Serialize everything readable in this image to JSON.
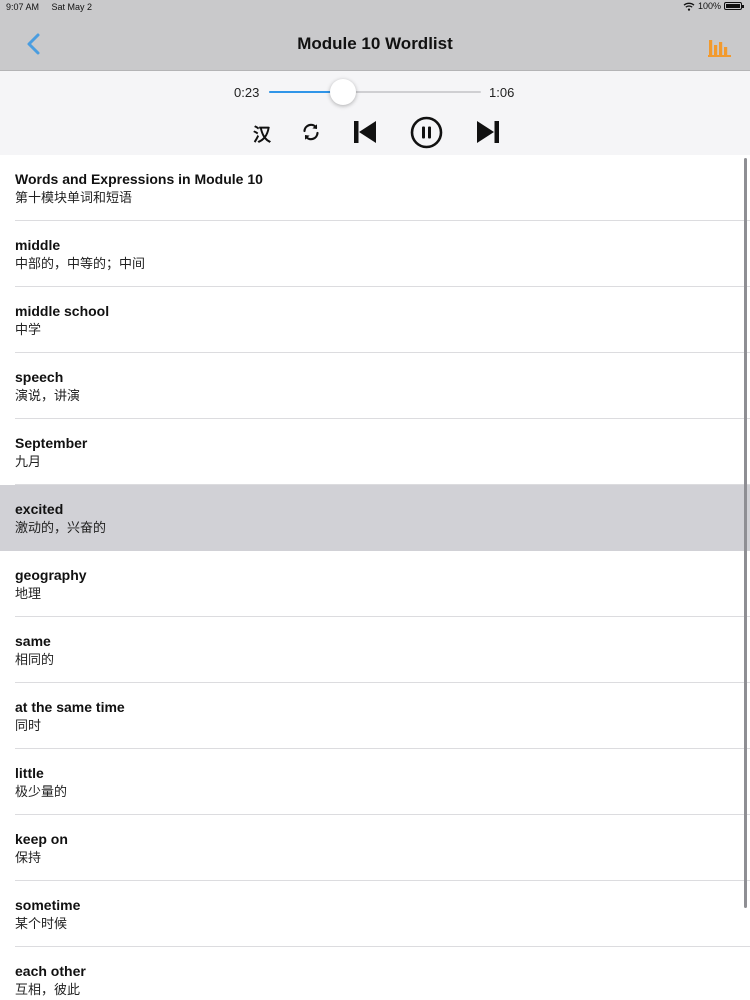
{
  "status_bar": {
    "time": "9:07 AM",
    "date": "Sat May 2",
    "battery": "100%",
    "wifi_icon": "wifi-icon",
    "battery_icon": "battery-icon"
  },
  "nav": {
    "title": "Module 10 Wordlist",
    "back_icon": "chevron-left-icon",
    "chart_icon": "bar-chart-icon",
    "accent_color": "#4a9de0",
    "chart_color": "#f29a2e"
  },
  "player": {
    "elapsed": "0:23",
    "total": "1:06",
    "progress": 0.35,
    "lang_toggle_label": "汉",
    "repeat_icon": "repeat-icon",
    "prev_icon": "skip-previous-icon",
    "pause_icon": "pause-icon",
    "next_icon": "skip-next-icon",
    "progress_color": "#2f95e8"
  },
  "words": [
    {
      "en": "Words and Expressions in Module 10",
      "zh": "第十模块单词和短语"
    },
    {
      "en": "middle",
      "zh": "中部的，中等的；中间"
    },
    {
      "en": "middle school",
      "zh": "中学"
    },
    {
      "en": "speech",
      "zh": "演说，讲演"
    },
    {
      "en": "September",
      "zh": "九月"
    },
    {
      "en": "excited",
      "zh": "激动的，兴奋的",
      "selected": true
    },
    {
      "en": "geography",
      "zh": "地理"
    },
    {
      "en": "same",
      "zh": "相同的"
    },
    {
      "en": "at the same time",
      "zh": "同时"
    },
    {
      "en": "little",
      "zh": "极少量的"
    },
    {
      "en": "keep on",
      "zh": "保持"
    },
    {
      "en": "sometime",
      "zh": "某个时候"
    },
    {
      "en": "each other",
      "zh": "互相，彼此"
    }
  ]
}
